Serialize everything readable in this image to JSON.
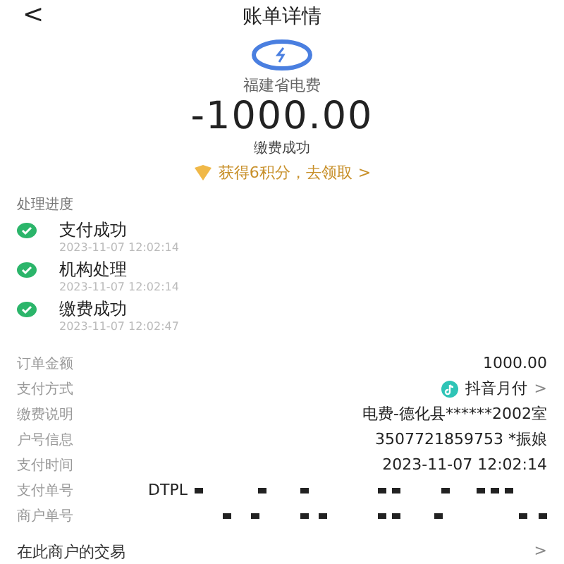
{
  "header": {
    "back": "<",
    "title": "账单详情"
  },
  "summary": {
    "merchant": "福建省电费",
    "amount": "-1000.00",
    "status": "缴费成功",
    "reward": "获得6积分，去领取",
    "reward_arrow": ">"
  },
  "progress": {
    "title": "处理进度",
    "steps": [
      {
        "label": "支付成功",
        "time": "2023-11-07 12:02:14",
        "done": true
      },
      {
        "label": "机构处理",
        "time": "2023-11-07 12:02:14",
        "done": true
      },
      {
        "label": "缴费成功",
        "time": "2023-11-07 12:02:47",
        "done": true
      }
    ]
  },
  "details": [
    {
      "kind": "text",
      "label": "订单金额",
      "value": "1000.00"
    },
    {
      "kind": "payment",
      "label": "支付方式",
      "value": "抖音月付",
      "arrow": ">"
    },
    {
      "kind": "text",
      "label": "缴费说明",
      "value": "电费-德化县******2002室"
    },
    {
      "kind": "text",
      "label": "户号信息",
      "value": "3507721859753 *振娘"
    },
    {
      "kind": "text",
      "label": "支付时间",
      "value": "2023-11-07 12:02:14"
    },
    {
      "kind": "redacted",
      "label": "支付单号",
      "value": "DTPL"
    },
    {
      "kind": "redacted",
      "label": "商户单号"
    }
  ],
  "footer_link": {
    "label": "在此商户的交易",
    "arrow": ">"
  }
}
